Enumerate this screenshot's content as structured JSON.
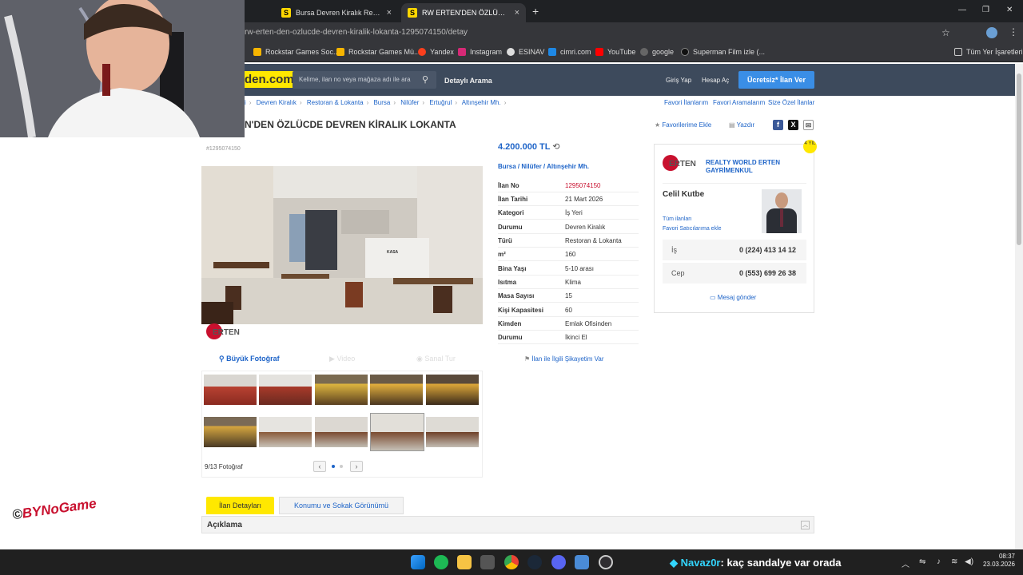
{
  "browser": {
    "tabs": [
      {
        "label": "Bursa Devren Kiralık Restoran &",
        "close": "×"
      },
      {
        "label": "RW ERTEN'DEN ÖZLÜCDE DEVREN",
        "close": "×"
      }
    ],
    "new_tab": "+",
    "url": "rw-erten-den-ozlucde-devren-kiralik-lokanta-1295074150/detay",
    "bookmarks": [
      {
        "label": "Rockstar Games Soc...",
        "color": "#f7b500"
      },
      {
        "label": "Rockstar Games Mü...",
        "color": "#f7b500"
      },
      {
        "label": "Yandex",
        "color": "#fc3f1d"
      },
      {
        "label": "Instagram",
        "color": "#d62976"
      },
      {
        "label": "ESINAV",
        "color": "#dddddd"
      },
      {
        "label": "cimri.com",
        "color": "#1e88e5"
      },
      {
        "label": "YouTube",
        "color": "#ff0000"
      },
      {
        "label": "google",
        "color": "#555555"
      },
      {
        "label": "Superman Film izle (...",
        "color": "#222222"
      }
    ],
    "all_bookmarks": "Tüm Yer İşaretleri",
    "window_controls": [
      "—",
      "❐",
      "✕"
    ]
  },
  "site": {
    "logo_text": "den.com",
    "search_placeholder": "Kelime, ilan no veya mağaza adı ile ara",
    "detailed_search": "Detaylı Arama",
    "login": "Giriş Yap",
    "register": "Hesap Aç",
    "post_ad": "Ücretsiz* İlan Ver"
  },
  "breadcrumb": [
    "i",
    "Devren Kiralık",
    "Restoran & Lokanta",
    "Bursa",
    "Nilüfer",
    "Ertuğrul",
    "Altınşehir Mh."
  ],
  "top_links": [
    "Favori İlanlarım",
    "Favori Aramalarım",
    "Size Özel İlanlar"
  ],
  "listing": {
    "title": "N'DEN ÖZLÜCDE DEVREN KİRALIK LOKANTA",
    "add_favorite": "Favorilerime Ekle",
    "print": "Yazdır",
    "ad_no_small": "#1295074150",
    "price": "4.200.000 TL",
    "location": [
      "Bursa",
      "Nilüfer",
      "Altınşehir Mh."
    ],
    "details": [
      {
        "key": "İlan No",
        "value": "1295074150"
      },
      {
        "key": "İlan Tarihi",
        "value": "21 Mart 2026"
      },
      {
        "key": "Kategori",
        "value": "İş Yeri"
      },
      {
        "key": "Durumu",
        "value": "Devren Kiralık"
      },
      {
        "key": "Türü",
        "value": "Restoran & Lokanta"
      },
      {
        "key": "m²",
        "value": "160"
      },
      {
        "key": "Bina Yaşı",
        "value": "5-10 arası"
      },
      {
        "key": "Isıtma",
        "value": "Klima"
      },
      {
        "key": "Masa Sayısı",
        "value": "15"
      },
      {
        "key": "Kişi Kapasitesi",
        "value": "60"
      },
      {
        "key": "Kimden",
        "value": "Emlak Ofisinden"
      },
      {
        "key": "Durumu",
        "value": "İkinci El"
      }
    ],
    "complain": "İlan ile İlgili Şikayetim Var",
    "media_tabs": [
      "Büyük Fotoğraf",
      "Video",
      "Sanal Tur"
    ],
    "photo_count": "9/13 Fotoğraf",
    "prev": "‹",
    "next": "›",
    "photo_kasa": "KASA",
    "photo_logo": "ERTEN"
  },
  "seller": {
    "store": "REALTY WORLD ERTEN GAYRİMENKUL",
    "logo": "ERTEN",
    "agent": "Celil Kutbe",
    "all_ads": "Tüm ilanları",
    "add_fav_seller": "Favori Satıcılarıma ekle",
    "phones": [
      {
        "key": "İş",
        "value": "0 (224) 413 14 12"
      },
      {
        "key": "Cep",
        "value": "0 (553) 699 26 38"
      }
    ],
    "send_message": "Mesaj gönder",
    "badge": "4 YIL"
  },
  "bottom_tabs": [
    "İlan Detayları",
    "Konumu ve Sokak Görünümü"
  ],
  "description": "Açıklama",
  "taskbar": {
    "chat_user": "Navaz0r",
    "chat_msg": ": kaç sandalye var orada",
    "time": "08:37",
    "date": "23.03.2026"
  },
  "watermark": {
    "pre": "©",
    "mid": "BYNoGam",
    "end": "e"
  },
  "colors": {
    "accent_blue": "#1e64c8",
    "brand_yellow": "#ffe800",
    "header": "#3d4a5c",
    "price_blue": "#1e64c8",
    "ad_no_red": "#c8102e"
  }
}
